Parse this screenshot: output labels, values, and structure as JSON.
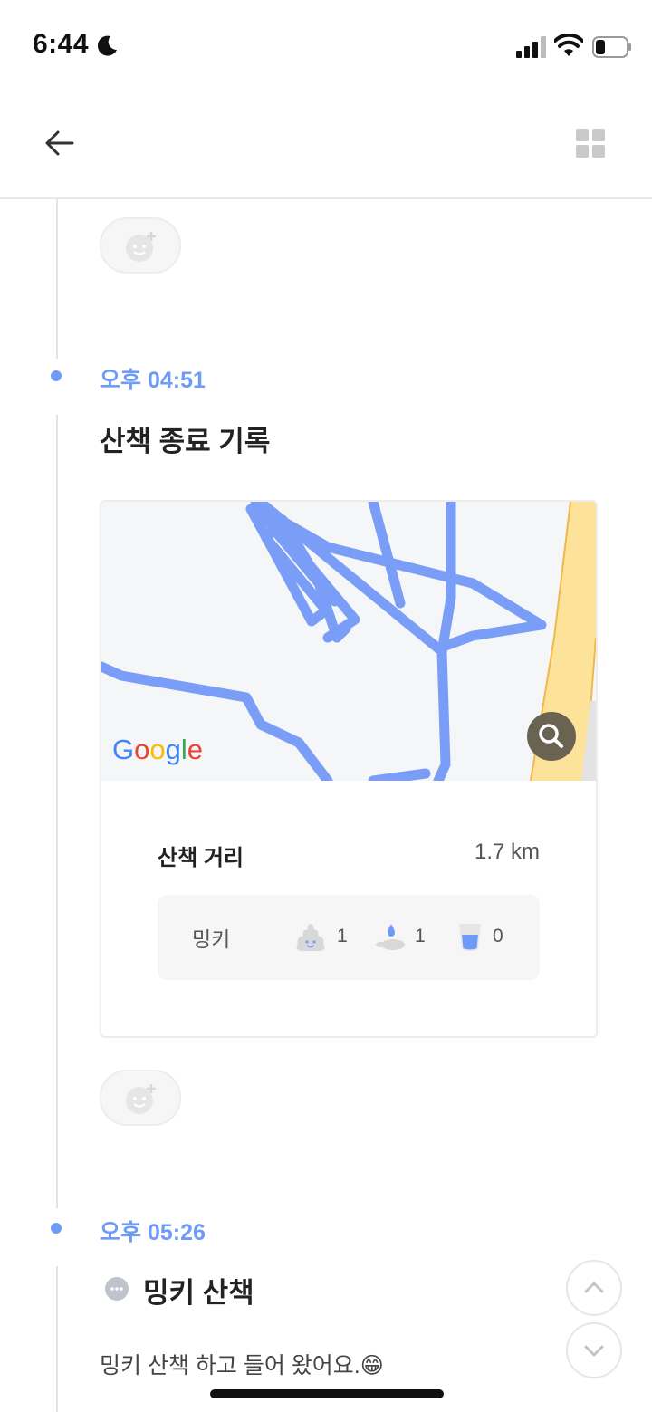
{
  "status_bar": {
    "time": "6:44"
  },
  "entries": [
    {
      "time": "오후 04:51",
      "title": "산책 종료 기록"
    },
    {
      "time": "오후 05:26",
      "title": "밍키 산책",
      "body": "밍키 산책 하고 들어 왔어요.😁"
    }
  ],
  "walk_card": {
    "map_provider": "Google",
    "distance_label": "산책 거리",
    "distance_value": "1.7 km",
    "pet": {
      "name": "밍키",
      "poop_count": "1",
      "pee_count": "1",
      "water_count": "0"
    }
  },
  "colors": {
    "accent": "#6e9bf7",
    "route": "#7a9ef7",
    "road": "#fde39a"
  },
  "icons": [
    "back-arrow-icon",
    "grid-icon",
    "add-reaction-icon",
    "search-icon",
    "poop-icon",
    "pee-icon",
    "water-cup-icon",
    "chat-bubble-icon",
    "chevron-up-icon",
    "chevron-down-icon"
  ]
}
